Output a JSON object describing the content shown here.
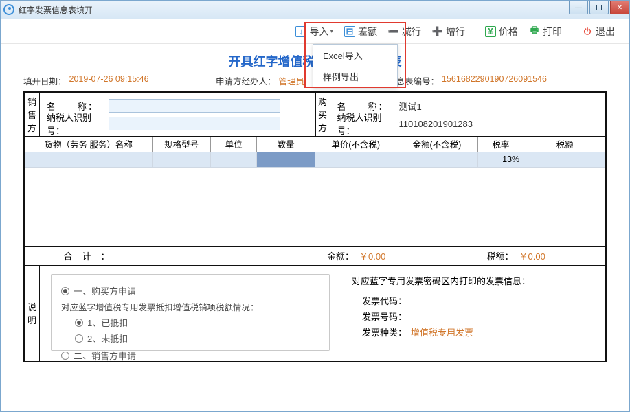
{
  "window": {
    "title": "红字发票信息表填开"
  },
  "toolbar": {
    "import": "导入",
    "diff": "差额",
    "minus_row": "减行",
    "plus_row": "增行",
    "price": "价格",
    "print": "打印",
    "exit": "退出",
    "dropdown": {
      "excel_import": "Excel导入",
      "sample_export": "样例导出"
    }
  },
  "title": "开具红字增值税专用发票信息表",
  "header": {
    "fill_date_label": "填开日期：",
    "fill_date": "2019-07-26 09:15:46",
    "applicant_label": "申请方经办人：",
    "applicant": "管理员",
    "info_no_label": "信息表编号：",
    "info_no": "1561682290190726091546"
  },
  "seller": {
    "side_label": "销售方",
    "name_label": "名　　称：",
    "name": "",
    "taxid_label": "纳税人识别号：",
    "taxid": ""
  },
  "buyer": {
    "side_label": "购买方",
    "name_label": "名　　称：",
    "name": "测试1",
    "taxid_label": "纳税人识别号：",
    "taxid": "110108201901283"
  },
  "table": {
    "cols": [
      "货物（劳务 服务）名称",
      "规格型号",
      "单位",
      "数量",
      "单价(不含税)",
      "金额(不含税)",
      "税率",
      "税额"
    ],
    "row1": {
      "rate": "13%"
    }
  },
  "total": {
    "label": "合计：",
    "amount_label": "金额：",
    "amount": "￥0.00",
    "tax_label": "税额：",
    "tax": "￥0.00"
  },
  "explain": {
    "side_label": "说明",
    "opt1": "一、购买方申请",
    "subtitle": "对应蓝字增值税专用发票抵扣增值税销项税额情况：",
    "opt1a": "1、已抵扣",
    "opt1b": "2、未抵扣",
    "opt2": "二、销售方申请",
    "right_title": "对应蓝字专用发票密码区内打印的发票信息：",
    "code_label": "发票代码：",
    "num_label": "发票号码：",
    "type_label": "发票种类：",
    "type_val": "增值税专用发票"
  }
}
